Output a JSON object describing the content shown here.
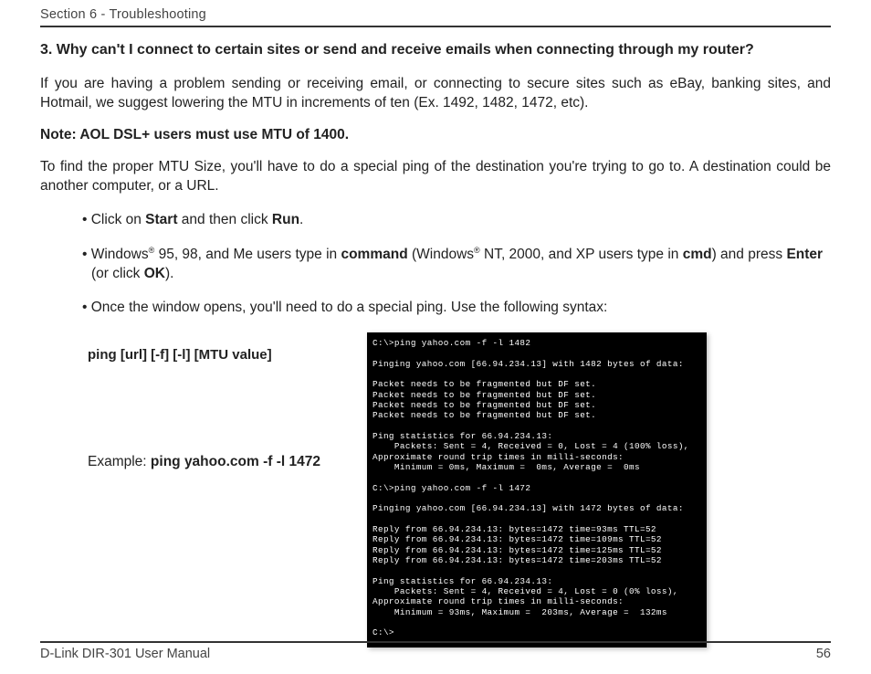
{
  "header": "Section 6 - Troubleshooting",
  "question": "3. Why can't I connect to certain sites or send and receive emails when connecting through my router?",
  "para1": "If you are having a problem sending or receiving email, or connecting to secure sites such as eBay, banking sites, and Hotmail, we suggest lowering the MTU in increments of ten (Ex. 1492, 1482, 1472, etc).",
  "note": "Note: AOL DSL+ users must use MTU of 1400.",
  "para2": "To find the proper MTU Size, you'll have to do a special ping of the destination you're trying to go to. A destination could be another computer, or a URL.",
  "bullets": {
    "b1_pre": "Click on ",
    "b1_start": "Start",
    "b1_mid": " and then click ",
    "b1_run": "Run",
    "b1_post": ".",
    "b2_pre": "Windows",
    "b2_reg": "®",
    "b2_a": " 95, 98, and Me users type in ",
    "b2_cmd1": "command",
    "b2_b": " (Windows",
    "b2_c": " NT, 2000, and XP users type in ",
    "b2_cmd2": "cmd",
    "b2_d": ") and press ",
    "b2_enter": "Enter",
    "b2_e": " (or click ",
    "b2_ok": "OK",
    "b2_f": ").",
    "b3": "Once the window opens, you'll need to do a special ping. Use the following syntax:"
  },
  "syntax": "ping [url] [-f] [-l] [MTU value]",
  "example_label": "Example: ",
  "example_cmd": "ping yahoo.com -f -l 1472",
  "terminal": "C:\\>ping yahoo.com -f -l 1482\n\nPinging yahoo.com [66.94.234.13] with 1482 bytes of data:\n\nPacket needs to be fragmented but DF set.\nPacket needs to be fragmented but DF set.\nPacket needs to be fragmented but DF set.\nPacket needs to be fragmented but DF set.\n\nPing statistics for 66.94.234.13:\n    Packets: Sent = 4, Received = 0, Lost = 4 (100% loss),\nApproximate round trip times in milli-seconds:\n    Minimum = 0ms, Maximum =  0ms, Average =  0ms\n\nC:\\>ping yahoo.com -f -l 1472\n\nPinging yahoo.com [66.94.234.13] with 1472 bytes of data:\n\nReply from 66.94.234.13: bytes=1472 time=93ms TTL=52\nReply from 66.94.234.13: bytes=1472 time=109ms TTL=52\nReply from 66.94.234.13: bytes=1472 time=125ms TTL=52\nReply from 66.94.234.13: bytes=1472 time=203ms TTL=52\n\nPing statistics for 66.94.234.13:\n    Packets: Sent = 4, Received = 4, Lost = 0 (0% loss),\nApproximate round trip times in milli-seconds:\n    Minimum = 93ms, Maximum =  203ms, Average =  132ms\n\nC:\\>",
  "footer_left": "D-Link DIR-301 User Manual",
  "footer_right": "56"
}
